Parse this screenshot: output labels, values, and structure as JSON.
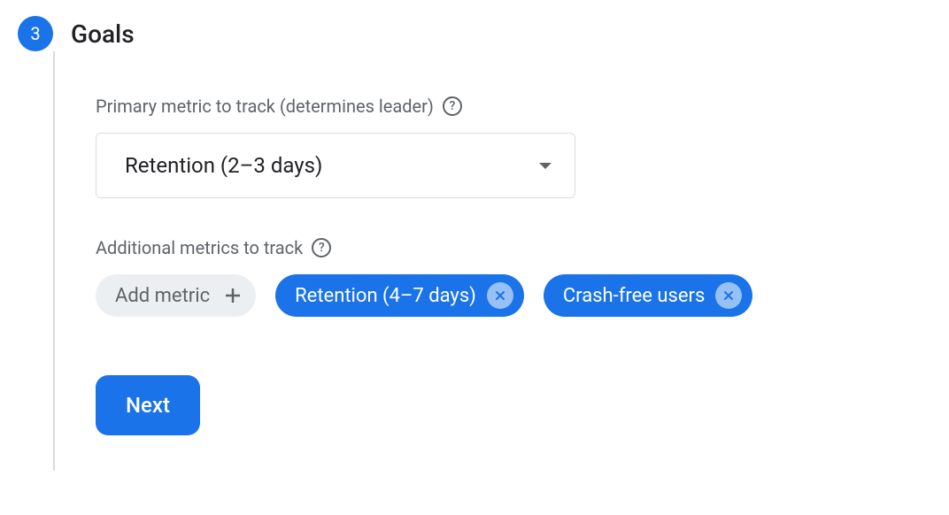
{
  "step": {
    "number": "3",
    "title": "Goals"
  },
  "primary_metric": {
    "label": "Primary metric to track (determines leader)",
    "selected": "Retention (2–3 days)"
  },
  "additional_metrics": {
    "label": "Additional metrics to track",
    "add_label": "Add metric",
    "chips": [
      {
        "label": "Retention (4–7 days)"
      },
      {
        "label": "Crash-free users"
      }
    ]
  },
  "next_button": "Next"
}
